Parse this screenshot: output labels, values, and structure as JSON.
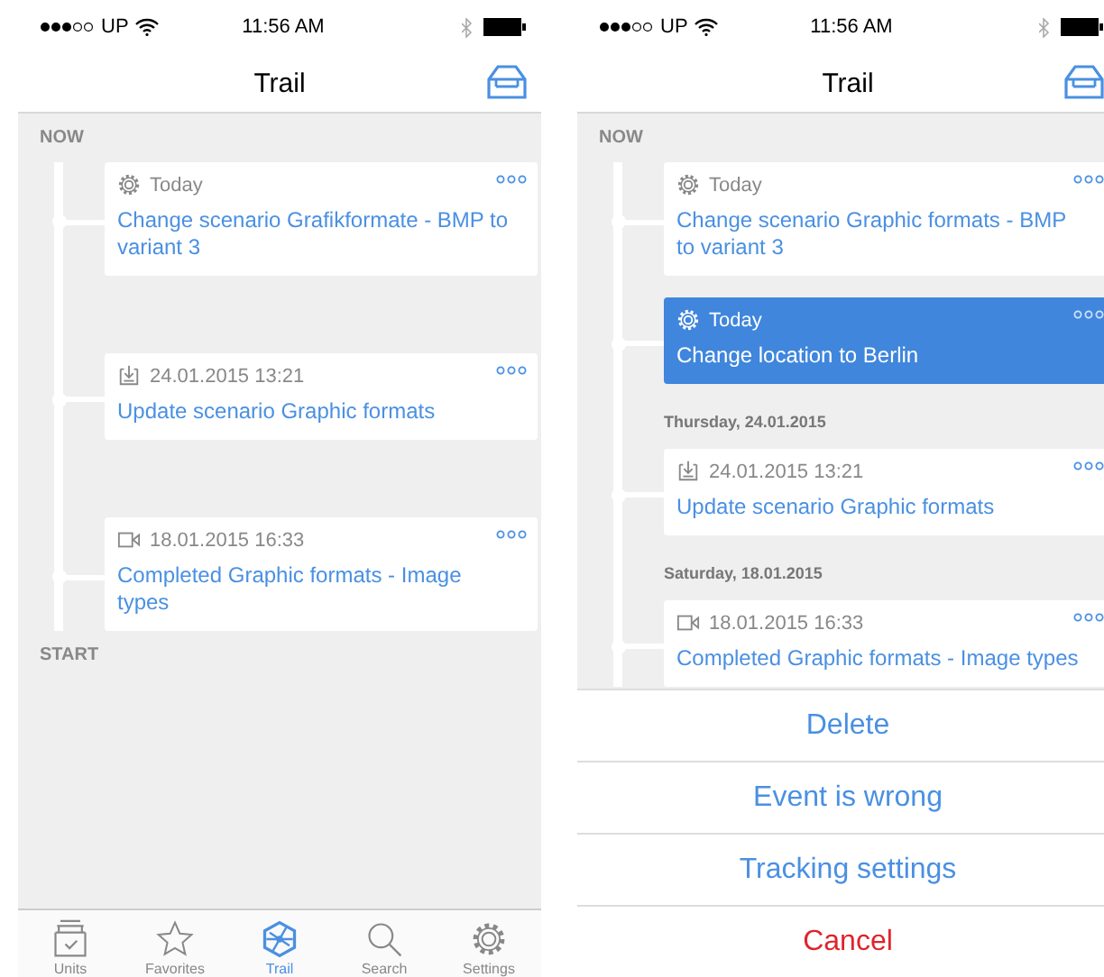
{
  "screens": [
    {
      "status": {
        "carrier": "UP",
        "time": "11:56 AM"
      },
      "title": "Trail",
      "top_label": "NOW",
      "bottom_label": "START",
      "items": [
        {
          "kind": "change",
          "time": "Today",
          "text": "Change scenario Grafikformate - BMP to variant 3",
          "selected": false
        },
        {
          "kind": "update",
          "time": "24.01.2015 13:21",
          "text": "Update scenario Graphic formats",
          "selected": false
        },
        {
          "kind": "completion",
          "time": "18.01.2015 16:33",
          "text": "Completed Graphic formats - Image types",
          "selected": false
        }
      ],
      "tabs": [
        {
          "kind": "units",
          "label": "Units",
          "selected": false
        },
        {
          "kind": "favorites",
          "label": "Favorites",
          "selected": false
        },
        {
          "kind": "trail",
          "label": "Trail",
          "selected": true
        },
        {
          "kind": "search",
          "label": "Search",
          "selected": false
        },
        {
          "kind": "settings",
          "label": "Settings",
          "selected": false
        }
      ]
    },
    {
      "status": {
        "carrier": "UP",
        "time": "11:56 AM"
      },
      "title": "Trail",
      "top_label": "NOW",
      "items": [
        {
          "kind": "change",
          "time": "Today",
          "text": "Change scenario Graphic formats - BMP to variant 3",
          "selected": false
        },
        {
          "kind": "change",
          "time": "Today",
          "text": "Change location to Berlin",
          "selected": true
        },
        {
          "kind": "day",
          "text": "Thursday, 24.01.2015"
        },
        {
          "kind": "update",
          "time": "24.01.2015 13:21",
          "text": "Update scenario Graphic formats",
          "selected": false
        },
        {
          "kind": "day",
          "text": "Saturday, 18.01.2015"
        },
        {
          "kind": "completion",
          "time": "18.01.2015 16:33",
          "text": "Completed Graphic formats - Image types",
          "selected": false
        }
      ],
      "action_sheet": [
        {
          "kind": "default",
          "label": "Delete"
        },
        {
          "kind": "default",
          "label": "Event is wrong"
        },
        {
          "kind": "default",
          "label": "Tracking settings"
        },
        {
          "kind": "cancel",
          "label": "Cancel"
        }
      ]
    }
  ]
}
